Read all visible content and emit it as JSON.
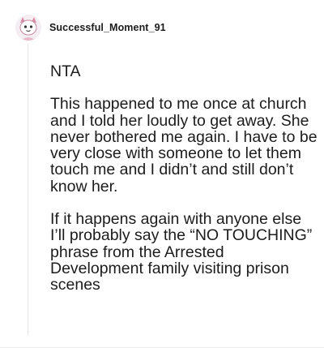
{
  "comment": {
    "username": "Successful_Moment_91",
    "avatar_icon": "user-avatar-icon",
    "paragraphs": [
      "NTA",
      "This happened to me once at church and I told her loudly to get away. She never bothered me again. I have to be very close with someone to let them touch me and I didn’t and still don’t know her.",
      "If it happens again with anyone else I’ll probably say the “NO TOUCHING” phrase from the Arrested Development family visiting prison scenes"
    ]
  },
  "colors": {
    "text": "#1c1c1c",
    "thread_line": "#e6e6e6",
    "avatar_bg": "#f4eef2",
    "avatar_accent": "#d98ba6"
  }
}
